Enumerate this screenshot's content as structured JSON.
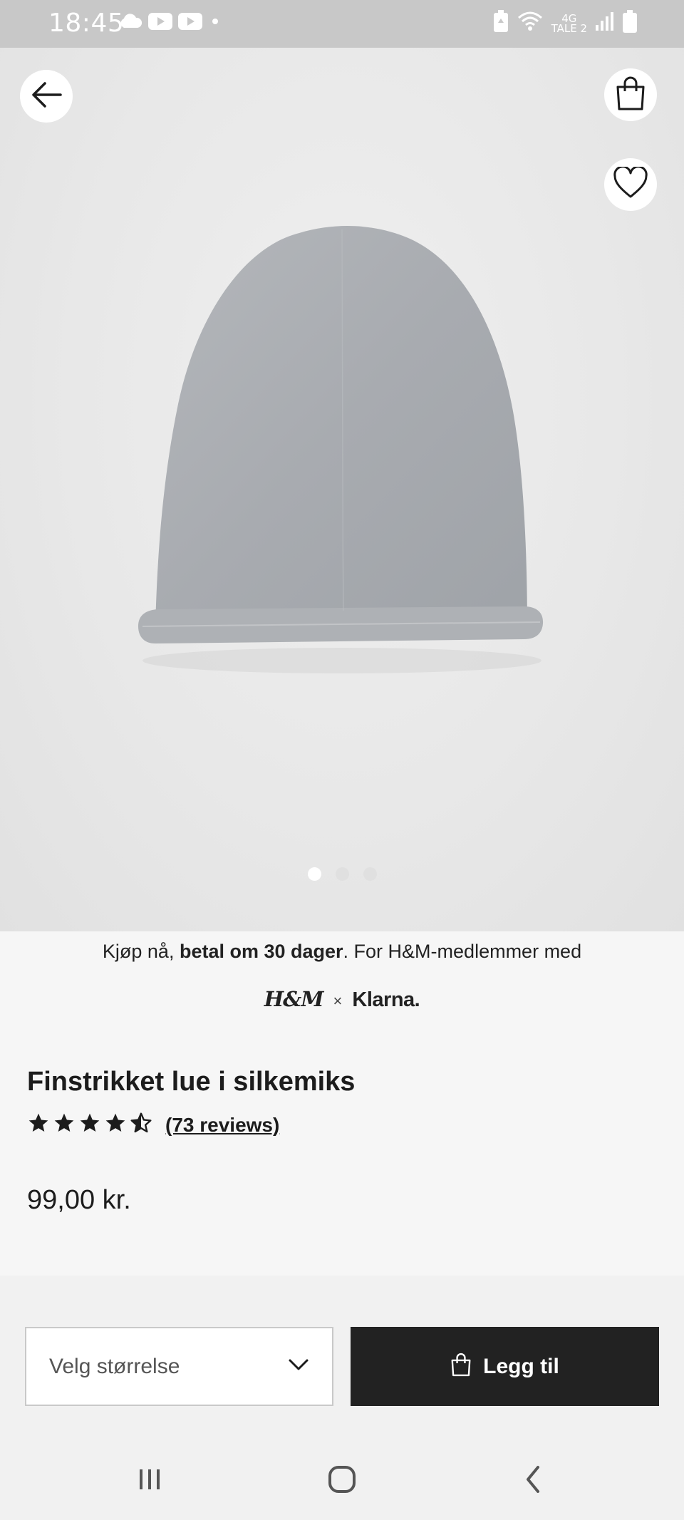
{
  "status_bar": {
    "time": "18:45",
    "network_top": "4G",
    "network_bottom": "TALE 2",
    "icons": [
      "cloud-icon",
      "youtube-icon",
      "youtube-icon",
      "dot-icon",
      "battery-saver-icon",
      "wifi-icon",
      "signal-icon",
      "battery-icon"
    ]
  },
  "hero": {
    "image": "grey-knit-beanie-photo",
    "carousel_count": 3,
    "carousel_active": 0,
    "back_icon": "arrow-left-icon",
    "bag_icon": "shopping-bag-icon",
    "favorite_icon": "heart-icon"
  },
  "klarna": {
    "text_pre": "Kjøp nå, ",
    "text_bold": "betal om 30 dager",
    "text_post": ". For H&M-medlemmer med",
    "hm_logo": "H&M",
    "times": "×",
    "klarna_logo": "Klarna."
  },
  "product": {
    "title": "Finstrikket lue i silkemiks",
    "rating": 4.5,
    "reviews_label": "(73 reviews)",
    "price": "99,00 kr."
  },
  "actions": {
    "size_placeholder": "Velg størrelse",
    "add_label": "Legg til"
  },
  "colors": {
    "status_bar": "#c8c8c8",
    "background": "#f6f6f6",
    "primary_button": "#222222",
    "hat": "#a9adb1"
  }
}
